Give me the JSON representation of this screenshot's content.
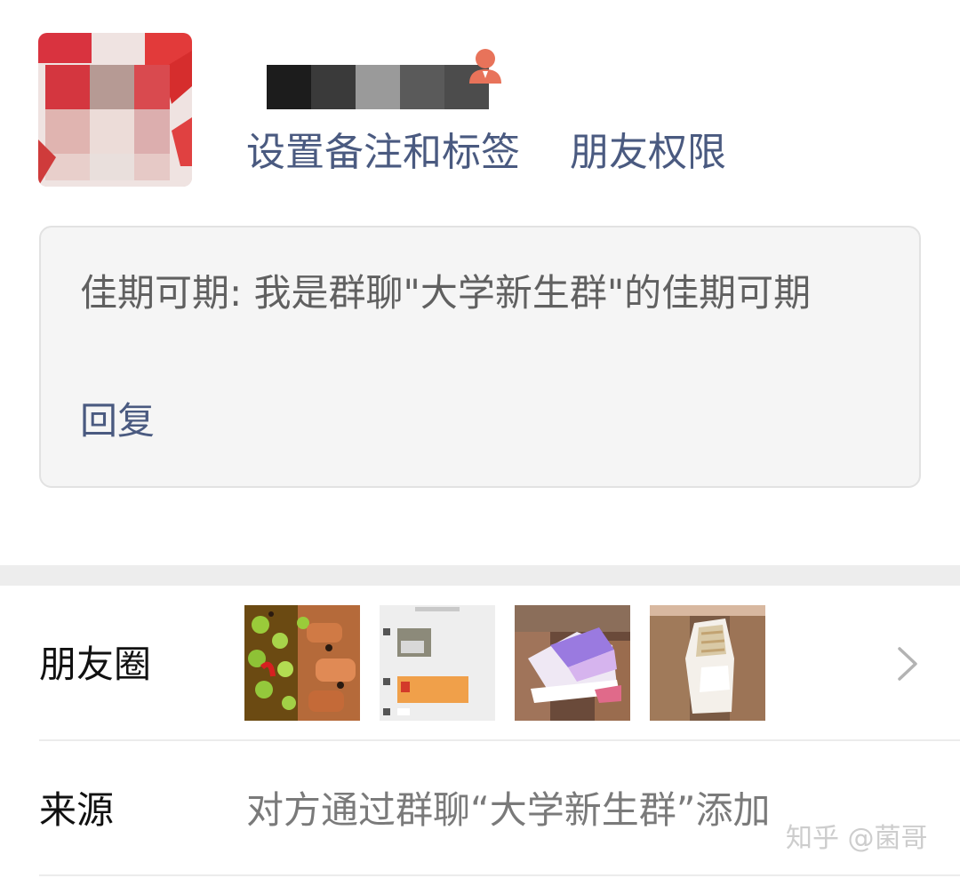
{
  "profile": {
    "avatar_icon": "blurred-avatar",
    "name_masked": true,
    "contact_icon": "person-icon",
    "actions": {
      "remark_tags": "设置备注和标签",
      "permissions": "朋友权限"
    }
  },
  "verification": {
    "message": "佳期可期: 我是群聊\"大学新生群\"的佳期可期",
    "reply_label": "回复"
  },
  "moments": {
    "label": "朋友圈",
    "thumbnails": [
      "food-photo",
      "chat-screenshot",
      "sneaker-photo-purple",
      "sneaker-photo-white"
    ],
    "chevron_icon": "chevron-right-icon"
  },
  "source": {
    "label": "来源",
    "value": "对方通过群聊“大学新生群”添加"
  },
  "watermark": "知乎 @菌哥",
  "colors": {
    "link": "#4a5a80",
    "card_bg": "#f5f5f5",
    "band": "#ededed",
    "contact_icon": "#e8735a"
  }
}
